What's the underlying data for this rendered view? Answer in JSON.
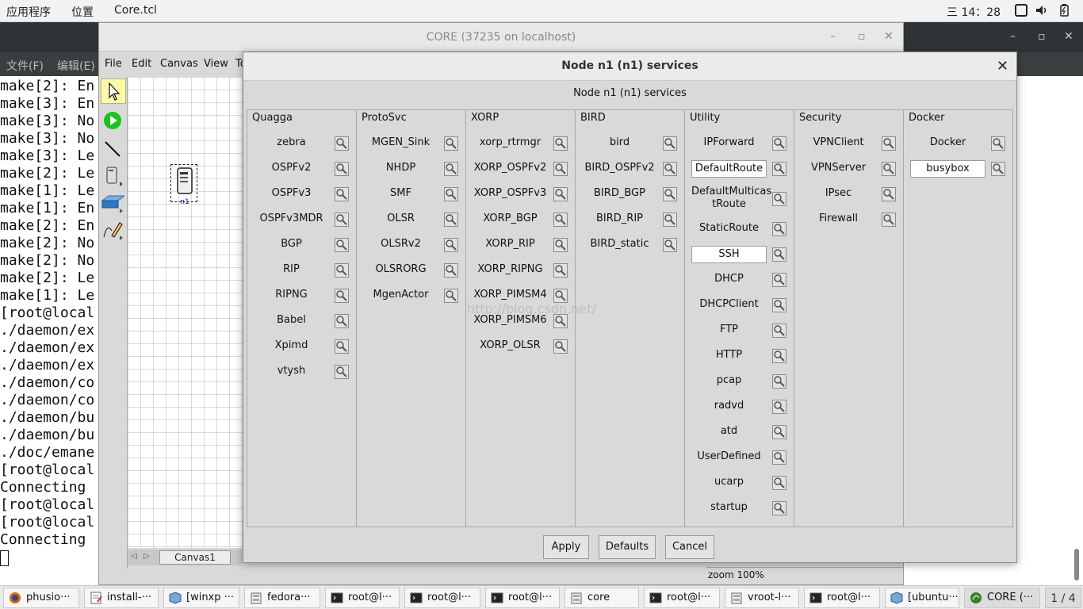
{
  "top_panel": {
    "apps_menu": "应用程序",
    "places_menu": "位置",
    "active_app": "Core.tcl",
    "clock": "三 14：28"
  },
  "terminal": {
    "menu_file": "文件(F)",
    "menu_edit": "编辑(E)",
    "lines": [
      "make[2]: En",
      "make[3]: En",
      "make[3]: No",
      "make[3]: No",
      "make[3]: Le",
      "make[2]: Le",
      "make[1]: Le",
      "make[1]: En",
      "make[2]: En",
      "make[2]: No",
      "make[2]: No",
      "make[2]: Le",
      "make[1]: Le",
      "[root@local",
      "./daemon/ex",
      "./daemon/ex",
      "./daemon/ex",
      "./daemon/co",
      "./daemon/co",
      "./daemon/bu",
      "./daemon/bu",
      "./doc/emane",
      "[root@local",
      "Connecting ",
      "[root@local",
      "[root@local",
      "Connecting "
    ]
  },
  "core": {
    "title": "CORE (37235 on localhost)",
    "menu": [
      "File",
      "Edit",
      "Canvas",
      "View",
      "To"
    ],
    "canvas_tab": "Canvas1",
    "node_label": "n1",
    "zoom": "zoom 100%"
  },
  "dialog": {
    "title": "Node n1 (n1) services",
    "heading": "Node n1 (n1) services",
    "watermark": "http://blog.csdn.net/",
    "columns": [
      {
        "name": "Quagga",
        "services": [
          {
            "label": "zebra",
            "on": false
          },
          {
            "label": "OSPFv2",
            "on": false
          },
          {
            "label": "OSPFv3",
            "on": false
          },
          {
            "label": "OSPFv3MDR",
            "on": false
          },
          {
            "label": "BGP",
            "on": false
          },
          {
            "label": "RIP",
            "on": false
          },
          {
            "label": "RIPNG",
            "on": false
          },
          {
            "label": "Babel",
            "on": false
          },
          {
            "label": "Xpimd",
            "on": false
          },
          {
            "label": "vtysh",
            "on": false
          }
        ]
      },
      {
        "name": "ProtoSvc",
        "services": [
          {
            "label": "MGEN_Sink",
            "on": false
          },
          {
            "label": "NHDP",
            "on": false
          },
          {
            "label": "SMF",
            "on": false
          },
          {
            "label": "OLSR",
            "on": false
          },
          {
            "label": "OLSRv2",
            "on": false
          },
          {
            "label": "OLSRORG",
            "on": false
          },
          {
            "label": "MgenActor",
            "on": false
          }
        ]
      },
      {
        "name": "XORP",
        "services": [
          {
            "label": "xorp_rtrmgr",
            "on": false
          },
          {
            "label": "XORP_OSPFv2",
            "on": false
          },
          {
            "label": "XORP_OSPFv3",
            "on": false
          },
          {
            "label": "XORP_BGP",
            "on": false
          },
          {
            "label": "XORP_RIP",
            "on": false
          },
          {
            "label": "XORP_RIPNG",
            "on": false
          },
          {
            "label": "XORP_PIMSM4",
            "on": false
          },
          {
            "label": "XORP_PIMSM6",
            "on": false
          },
          {
            "label": "XORP_OLSR",
            "on": false
          }
        ]
      },
      {
        "name": "BIRD",
        "services": [
          {
            "label": "bird",
            "on": false
          },
          {
            "label": "BIRD_OSPFv2",
            "on": false
          },
          {
            "label": "BIRD_BGP",
            "on": false
          },
          {
            "label": "BIRD_RIP",
            "on": false
          },
          {
            "label": "BIRD_static",
            "on": false
          }
        ]
      },
      {
        "name": "Utility",
        "services": [
          {
            "label": "IPForward",
            "on": false
          },
          {
            "label": "DefaultRoute",
            "on": true
          },
          {
            "label": "DefaultMulticastRoute",
            "lines": [
              "DefaultMulticas",
              "tRoute"
            ],
            "on": false
          },
          {
            "label": "StaticRoute",
            "on": false
          },
          {
            "label": "SSH",
            "on": true
          },
          {
            "label": "DHCP",
            "on": false
          },
          {
            "label": "DHCPClient",
            "on": false
          },
          {
            "label": "FTP",
            "on": false
          },
          {
            "label": "HTTP",
            "on": false
          },
          {
            "label": "pcap",
            "on": false
          },
          {
            "label": "radvd",
            "on": false
          },
          {
            "label": "atd",
            "on": false
          },
          {
            "label": "UserDefined",
            "on": false
          },
          {
            "label": "ucarp",
            "on": false
          },
          {
            "label": "startup",
            "on": false
          }
        ]
      },
      {
        "name": "Security",
        "services": [
          {
            "label": "VPNClient",
            "on": false
          },
          {
            "label": "VPNServer",
            "on": false
          },
          {
            "label": "IPsec",
            "on": false
          },
          {
            "label": "Firewall",
            "on": false
          }
        ]
      },
      {
        "name": "Docker",
        "services": [
          {
            "label": "Docker",
            "on": false
          },
          {
            "label": "busybox",
            "on": true
          }
        ]
      }
    ],
    "apply_label": "Apply",
    "defaults_label": "Defaults",
    "cancel_label": "Cancel"
  },
  "taskbar": {
    "tasks": [
      {
        "label": "phusio···",
        "icon": "firefox-icon"
      },
      {
        "label": "install-···",
        "icon": "text-editor-icon"
      },
      {
        "label": "[winxp ···",
        "icon": "virtualbox-icon"
      },
      {
        "label": "fedora···",
        "icon": "file-manager-icon"
      },
      {
        "label": "root@l···",
        "icon": "terminal-icon"
      },
      {
        "label": "root@l···",
        "icon": "terminal-icon"
      },
      {
        "label": "root@l···",
        "icon": "terminal-icon"
      },
      {
        "label": "core",
        "icon": "file-manager-icon"
      },
      {
        "label": "root@l···",
        "icon": "terminal-icon"
      },
      {
        "label": "vroot-l···",
        "icon": "file-manager-icon"
      },
      {
        "label": "root@l···",
        "icon": "terminal-icon"
      },
      {
        "label": "[ubuntu···",
        "icon": "virtualbox-icon"
      },
      {
        "label": "CORE (···",
        "icon": "core-icon"
      }
    ],
    "pager": "1 / 4"
  }
}
